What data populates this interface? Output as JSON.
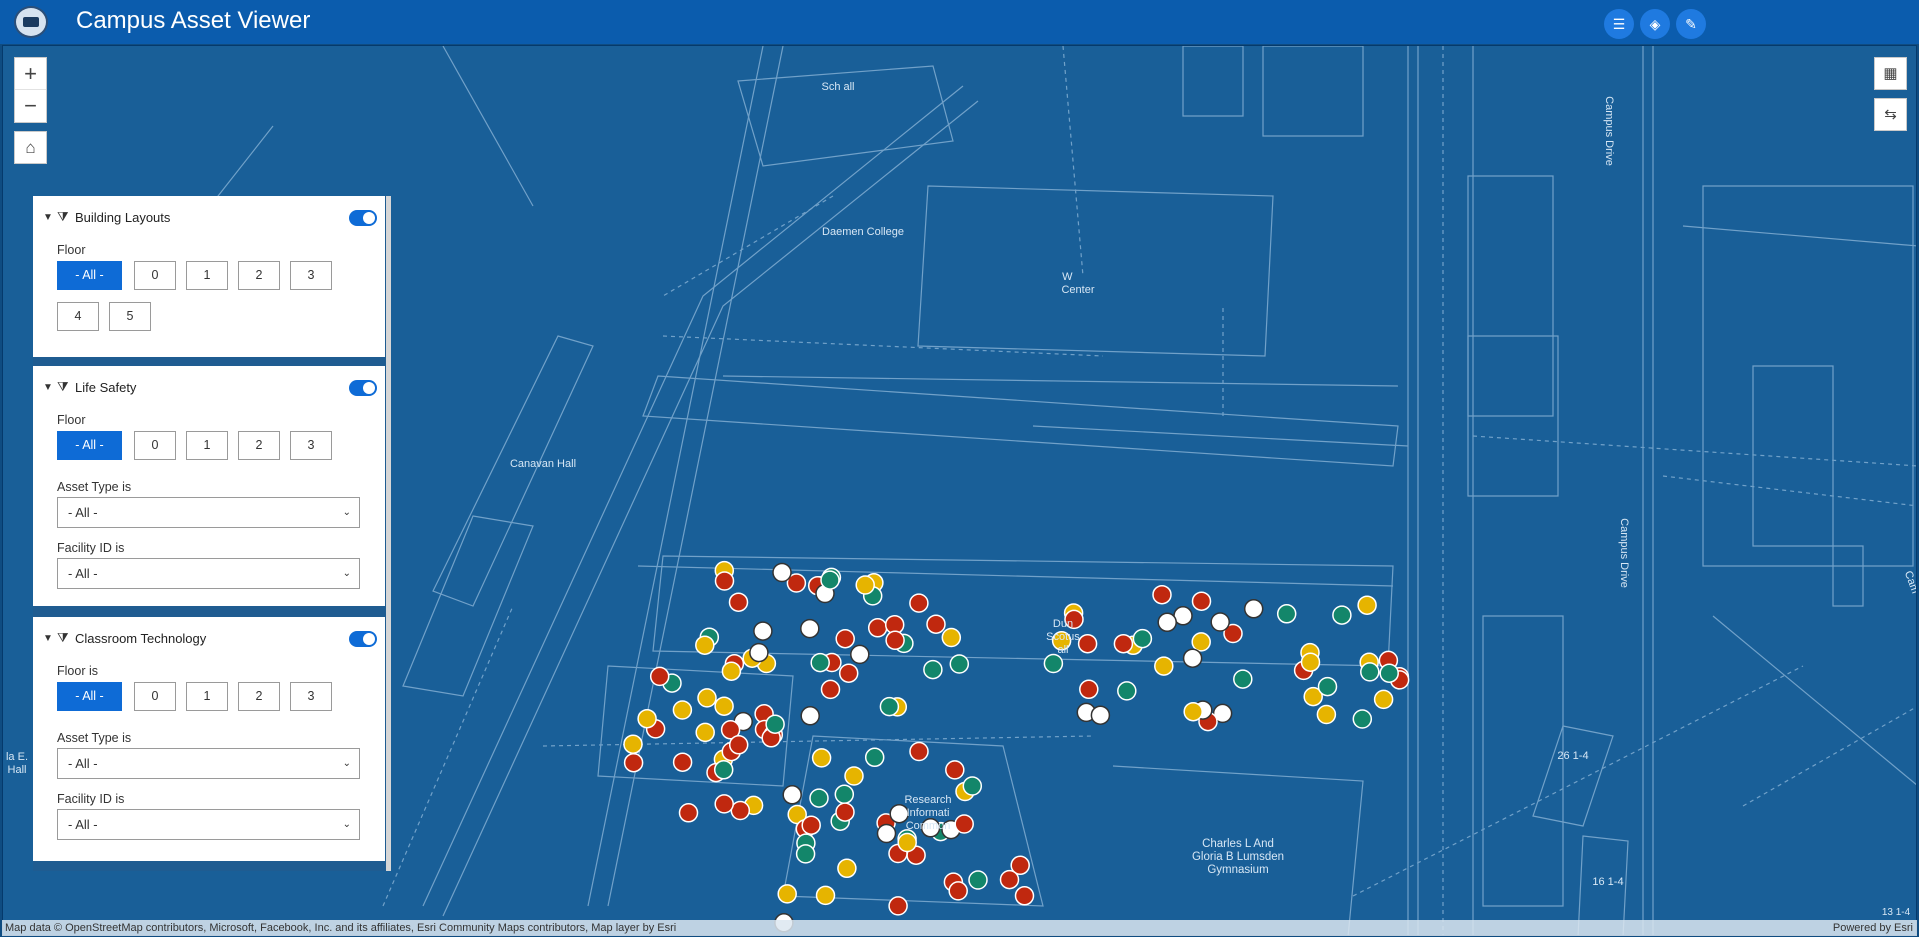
{
  "header": {
    "title": "Campus Asset Viewer",
    "buttons": [
      {
        "name": "list-icon"
      },
      {
        "name": "layers-icon"
      },
      {
        "name": "edit-icon"
      }
    ]
  },
  "map": {
    "labels": {
      "schwartz_hall": "Sch       all",
      "daemen_college": "Daemen College",
      "center": "W       \nCenter",
      "canavan_hall": "Canavan Hall",
      "campus_drive_1": "Campus Drive",
      "campus_drive_2": "Campus Drive",
      "duns_scotus": "Dun\nScotus\nall",
      "research_commons": "Research\nInformati\nCommon",
      "lumsden_gym": "Charles L And\nGloria B Lumsden\nGymnasium",
      "lot_26": "26 1-4",
      "lot_16": "16 1-4",
      "lot_13": "13 1-4",
      "hall_left": "la E.\nHall",
      "cam_right": "Cam"
    },
    "zoom_in": "+",
    "zoom_out": "−",
    "attribution": "Map data © OpenStreetMap contributors, Microsoft, Facebook, Inc. and its affiliates, Esri Community Maps contributors, Map layer by Esri",
    "powered_by": "Powered by Esri",
    "marker_colors": {
      "fire": "#c0280f",
      "green": "#13866a",
      "yellow": "#e6b400",
      "white": "#ffffff"
    }
  },
  "panel": {
    "sections": [
      {
        "title": "Building Layouts",
        "enabled": true,
        "floor_label": "Floor",
        "floors": [
          "- All -",
          "0",
          "1",
          "2",
          "3",
          "4",
          "5"
        ]
      },
      {
        "title": "Life Safety",
        "enabled": true,
        "floor_label": "Floor",
        "floors": [
          "- All -",
          "0",
          "1",
          "2",
          "3"
        ],
        "asset_type_label": "Asset Type is",
        "asset_type_value": "- All -",
        "facility_label": "Facility ID is",
        "facility_value": "- All -"
      },
      {
        "title": "Classroom Technology",
        "enabled": true,
        "floor_label": "Floor is",
        "floors": [
          "- All -",
          "0",
          "1",
          "2",
          "3"
        ],
        "asset_type_label": "Asset Type is",
        "asset_type_value": "- All -",
        "facility_label": "Facility ID is",
        "facility_value": "- All -"
      }
    ]
  }
}
